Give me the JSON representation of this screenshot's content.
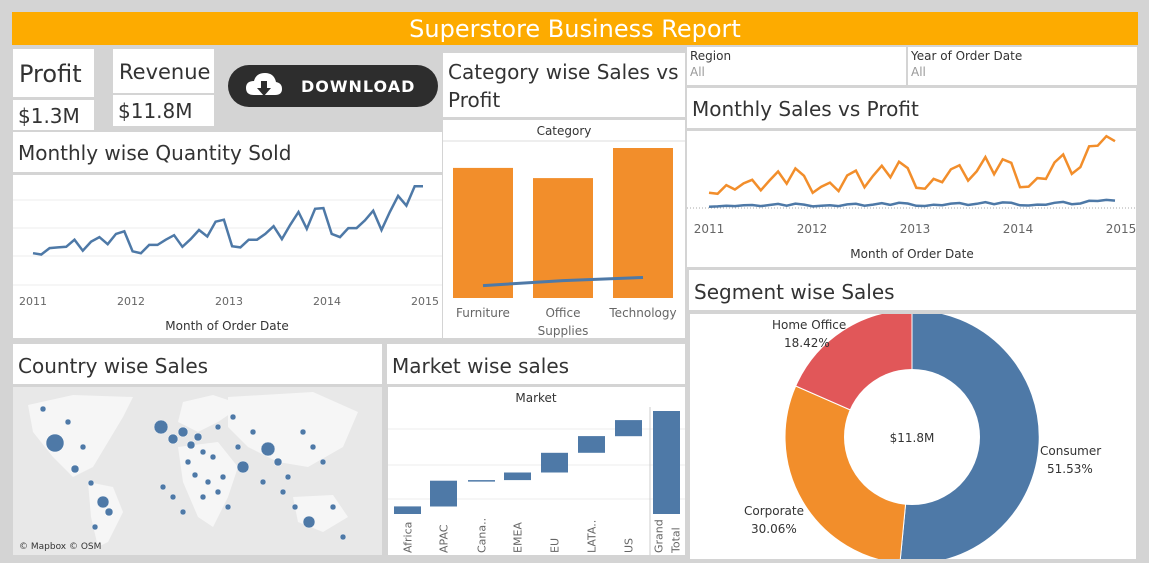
{
  "title": "Superstore Business Report",
  "kpis": {
    "profit_label": "Profit",
    "profit_value": "$1.3M",
    "revenue_label": "Revenue",
    "revenue_value": "$11.8M"
  },
  "download": {
    "label": "DOWNLOAD",
    "icon": "cloud-download-icon"
  },
  "filters": [
    {
      "label": "Region",
      "value": "All"
    },
    {
      "label": "Year of Order Date",
      "value": "All"
    }
  ],
  "panels": {
    "category_title": "Category wise Sales vs Profit",
    "monthly_qty_title": "Monthly wise Quantity Sold",
    "monthly_sales_title": "Monthly Sales vs Profit",
    "segment_title": "Segment wise Sales",
    "country_title": "Country wise Sales",
    "market_title": "Market wise sales",
    "map_credit": "© Mapbox © OSM"
  },
  "colors": {
    "banner": "#fdab00",
    "blue": "#4e79a7",
    "orange": "#f28e2b",
    "red": "#e15759",
    "map_dot": "#4e79a7"
  },
  "chart_data": [
    {
      "id": "quantity",
      "type": "line",
      "xlabel": "Month of Order Date",
      "x_ticks": [
        "2011",
        "2012",
        "2013",
        "2014",
        "2015"
      ],
      "series": [
        {
          "values": [
            260,
            240,
            340,
            350,
            360,
            470,
            300,
            440,
            510,
            400,
            560,
            600,
            290,
            260,
            390,
            390,
            470,
            540,
            360,
            480,
            620,
            520,
            750,
            780,
            370,
            350,
            470,
            470,
            560,
            680,
            480,
            700,
            900,
            640,
            950,
            960,
            560,
            510,
            650,
            650,
            770,
            920,
            620,
            900,
            1150,
            1000,
            1300,
            1300
          ]
        }
      ]
    },
    {
      "id": "category",
      "type": "bar",
      "header": "Category",
      "categories": [
        "Furniture",
        "Office Supplies",
        "Technology"
      ],
      "series": [
        {
          "values": [
            4.11,
            3.79,
            4.74
          ]
        },
        {
          "values": [
            0.29,
            0.52,
            0.66
          ]
        }
      ]
    },
    {
      "id": "monthly_sales_profit",
      "type": "line",
      "xlabel": "Month of Order Date",
      "x_ticks": [
        "2011",
        "2012",
        "2013",
        "2014",
        "2015"
      ],
      "series": [
        {
          "values": [
            98,
            91,
            146,
            118,
            158,
            180,
            113,
            176,
            233,
            155,
            253,
            206,
            97,
            136,
            162,
            108,
            208,
            239,
            132,
            206,
            270,
            196,
            296,
            255,
            129,
            123,
            186,
            165,
            247,
            273,
            175,
            235,
            325,
            216,
            311,
            289,
            133,
            137,
            191,
            186,
            291,
            342,
            218,
            261,
            394,
            398,
            459,
            427
          ]
        },
        {
          "values": [
            8,
            10,
            14,
            12,
            17,
            19,
            12,
            19,
            26,
            15,
            28,
            22,
            10,
            14,
            18,
            12,
            23,
            27,
            15,
            22,
            31,
            20,
            33,
            29,
            14,
            13,
            21,
            18,
            28,
            32,
            19,
            27,
            38,
            24,
            36,
            33,
            17,
            16,
            22,
            21,
            33,
            39,
            24,
            29,
            46,
            45,
            52,
            47
          ]
        }
      ]
    },
    {
      "id": "segment",
      "type": "pie",
      "center_label": "$11.8M",
      "slices": [
        {
          "label": "Consumer",
          "value": 51.53,
          "display": "51.53%"
        },
        {
          "label": "Corporate",
          "value": 30.06,
          "display": "30.06%"
        },
        {
          "label": "Home Office",
          "value": 18.42,
          "display": "18.42%"
        }
      ]
    },
    {
      "id": "market",
      "type": "bar",
      "header": "Market",
      "categories": [
        "Africa",
        "APAC",
        "Cana..",
        "EMEA",
        "EU",
        "LATA..",
        "US",
        "Grand Total"
      ],
      "values": [
        0.25,
        0.85,
        0.02,
        0.25,
        0.65,
        0.55,
        0.53,
        3.4
      ]
    }
  ]
}
